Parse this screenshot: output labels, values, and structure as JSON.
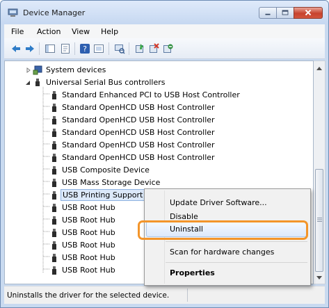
{
  "window": {
    "title": "Device Manager"
  },
  "menubar": {
    "items": [
      "File",
      "Action",
      "View",
      "Help"
    ]
  },
  "toolbar": {
    "icons": [
      "back-arrow-icon",
      "forward-arrow-icon",
      "show-hide-console-tree-icon",
      "properties-icon",
      "help-icon",
      "view-icon",
      "scan-hardware-icon",
      "update-driver-icon",
      "uninstall-icon",
      "disable-icon"
    ]
  },
  "tree": {
    "system_devices": "System devices",
    "usb_controllers": "Universal Serial Bus controllers",
    "children": [
      "Standard Enhanced PCI to USB Host Controller",
      "Standard OpenHCD USB Host Controller",
      "Standard OpenHCD USB Host Controller",
      "Standard OpenHCD USB Host Controller",
      "Standard OpenHCD USB Host Controller",
      "Standard OpenHCD USB Host Controller",
      "USB Composite Device",
      "USB Mass Storage Device",
      "USB Printing Support",
      "USB Root Hub",
      "USB Root Hub",
      "USB Root Hub",
      "USB Root Hub",
      "USB Root Hub",
      "USB Root Hub"
    ]
  },
  "context_menu": {
    "update_driver": "Update Driver Software...",
    "disable": "Disable",
    "uninstall": "Uninstall",
    "scan": "Scan for hardware changes",
    "properties": "Properties"
  },
  "statusbar": {
    "text": "Uninstalls the driver for the selected device."
  },
  "colors": {
    "accent_highlight": "#f3952b",
    "selection": "#dde9fb",
    "frame": "#c9daf0"
  }
}
